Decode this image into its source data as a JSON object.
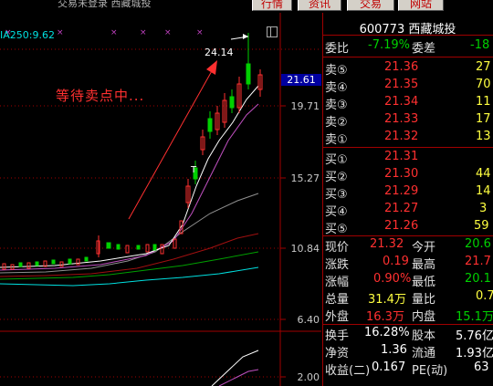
{
  "header": {
    "title": "交易未登录  西藏城投",
    "buttons": [
      "行情",
      "资讯",
      "交易",
      "网站"
    ]
  },
  "chart": {
    "ma_label": "IA250:9.62",
    "annotation": "等待卖点中...",
    "peak_label": "24.14",
    "current_price_tag": "21.61",
    "y_ticks": [
      "19.71",
      "15.27",
      "10.84",
      "6.40",
      "2.00"
    ],
    "marker": "T"
  },
  "quote": {
    "code": "600773",
    "name": "西藏城投",
    "weibi_label": "委比",
    "weibi_value": "-7.19%",
    "weicha_label": "委差",
    "weicha_value": "-18",
    "sells": [
      {
        "label": "卖⑤",
        "price": "21.36",
        "vol": "27"
      },
      {
        "label": "卖④",
        "price": "21.35",
        "vol": "70"
      },
      {
        "label": "卖③",
        "price": "21.34",
        "vol": "11"
      },
      {
        "label": "卖②",
        "price": "21.33",
        "vol": "17"
      },
      {
        "label": "卖①",
        "price": "21.32",
        "vol": "13"
      }
    ],
    "buys": [
      {
        "label": "买①",
        "price": "21.31",
        "vol": ""
      },
      {
        "label": "买②",
        "price": "21.30",
        "vol": "44"
      },
      {
        "label": "买③",
        "price": "21.29",
        "vol": "14"
      },
      {
        "label": "买④",
        "price": "21.27",
        "vol": "3"
      },
      {
        "label": "买⑤",
        "price": "21.26",
        "vol": "59"
      }
    ],
    "stats": [
      {
        "l1": "现价",
        "v1": "21.32",
        "l2": "今开",
        "v2": "20.6"
      },
      {
        "l1": "涨跌",
        "v1": "0.19",
        "l2": "最高",
        "v2": "21.7"
      },
      {
        "l1": "涨幅",
        "v1": "0.90%",
        "l2": "最低",
        "v2": "20.1"
      },
      {
        "l1": "总量",
        "v1": "31.4万",
        "l2": "量比",
        "v2": "0.7"
      },
      {
        "l1": "外盘",
        "v1": "16.3万",
        "l2": "内盘",
        "v2": "15.1万"
      },
      {
        "l1": "换手",
        "v1": "16.28%",
        "l2": "股本",
        "v2": "5.76亿"
      },
      {
        "l1": "净资",
        "v1": "1.36",
        "l2": "流通",
        "v2": "1.93亿"
      },
      {
        "l1": "收益(二)",
        "v1": "0.167",
        "l2": "PE(动)",
        "v2": "63"
      }
    ]
  }
}
